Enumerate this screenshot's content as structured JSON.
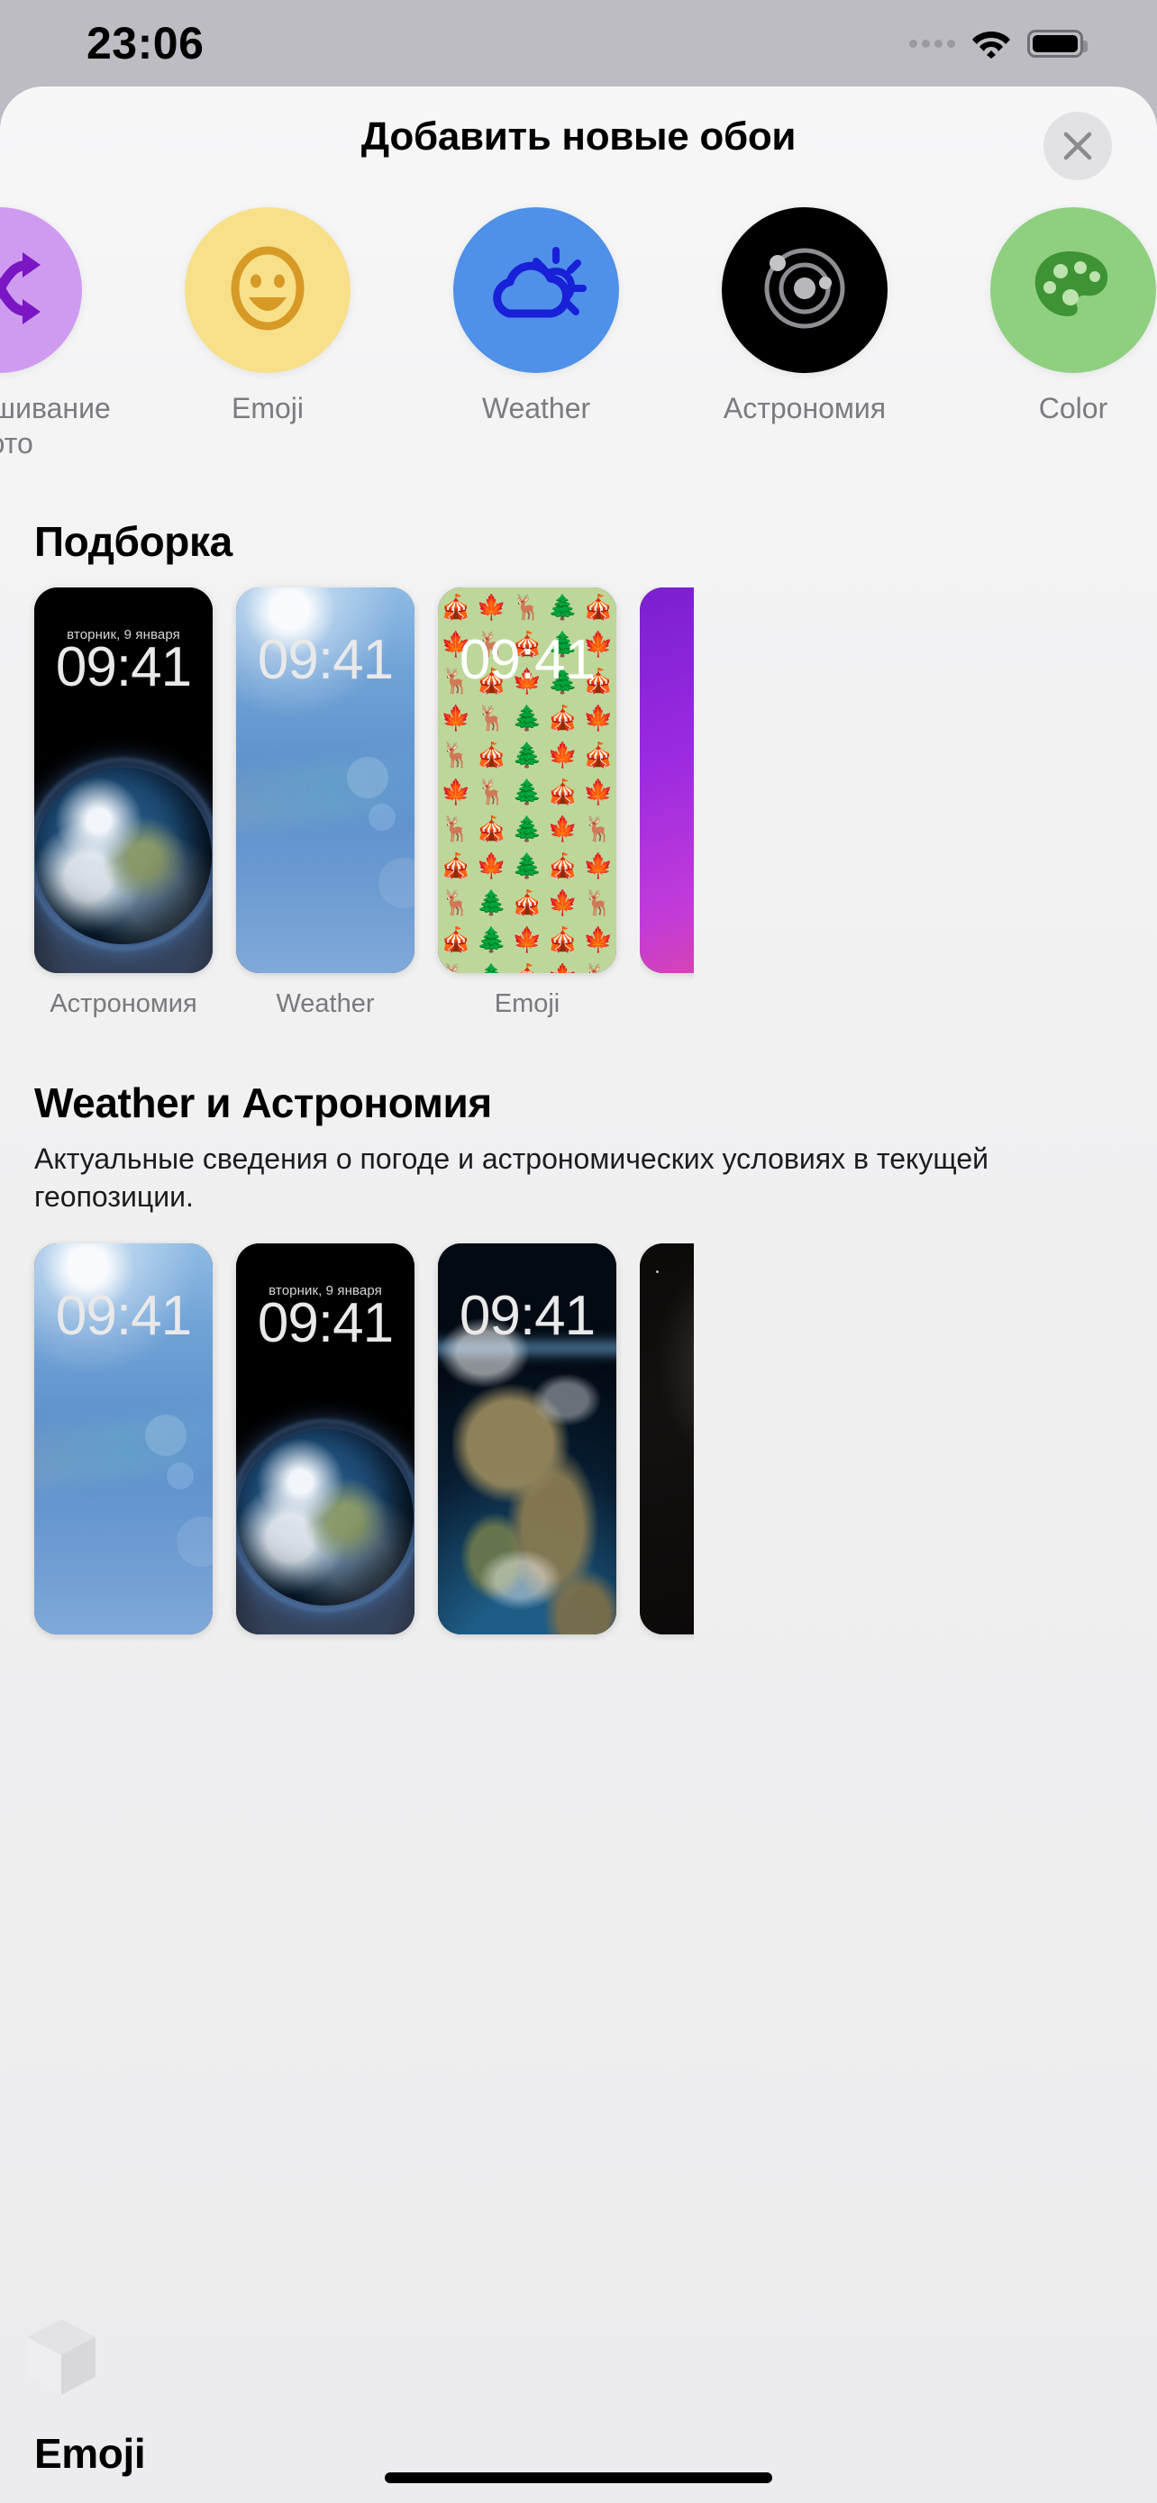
{
  "status_bar": {
    "time": "23:06",
    "wifi_icon": "wifi-icon",
    "battery_icon": "battery-icon",
    "signal_icon": "cellular-dots-icon"
  },
  "header": {
    "title": "Добавить новые обои",
    "close_icon": "close-icon"
  },
  "categories": [
    {
      "label": "Перемешивание фото",
      "icon": "shuffle-icon",
      "bg": "#cf9bf0",
      "fg": "#7a16c4"
    },
    {
      "label": "Emoji",
      "icon": "smiley-icon",
      "bg": "#f7e089",
      "fg": "#d79a26"
    },
    {
      "label": "Weather",
      "icon": "sun-behind-cloud-icon",
      "bg": "#4f90e8",
      "fg": "#1820d8"
    },
    {
      "label": "Астрономия",
      "icon": "solar-system-icon",
      "bg": "#000000",
      "fg": "#9a9a9a"
    },
    {
      "label": "Color",
      "icon": "paint-palette-icon",
      "bg": "#8fd080",
      "fg": "#3e9434"
    }
  ],
  "sections": [
    {
      "title": "Подборка",
      "description": "",
      "cards": [
        {
          "caption": "Астрономия",
          "style": "astronomy-earth",
          "date": "вторник, 9 января",
          "time": "09:41"
        },
        {
          "caption": "Weather",
          "style": "weather-blue-sky",
          "date": "",
          "time": "09:41"
        },
        {
          "caption": "Emoji",
          "style": "emoji-pattern",
          "date": "",
          "time": "09:41"
        },
        {
          "caption": "",
          "style": "purple-gradient",
          "date": "",
          "time": ""
        }
      ]
    },
    {
      "title": "Weather и Астрономия",
      "description": "Актуальные сведения о погоде и астрономических условиях в текущей геопозиции.",
      "cards": [
        {
          "caption": "",
          "style": "weather-blue-sky",
          "date": "",
          "time": "09:41"
        },
        {
          "caption": "",
          "style": "astronomy-earth",
          "date": "вторник, 9 января",
          "time": "09:41"
        },
        {
          "caption": "",
          "style": "earth-closeup",
          "date": "",
          "time": "09:41"
        },
        {
          "caption": "",
          "style": "night-sky",
          "date": "",
          "time": ""
        }
      ]
    }
  ],
  "bottom_section": {
    "title": "Emoji",
    "icon": "emoji-cube-icon"
  },
  "emoji_pattern": {
    "glyphs": [
      "🎪",
      "🍁",
      "🦌",
      "🌲",
      "🎪",
      "🍁",
      "🦌",
      "🎪",
      "🌲",
      "🍁",
      "🦌",
      "🎪",
      "🍁",
      "🌲",
      "🎪",
      "🍁",
      "🦌",
      "🌲",
      "🎪",
      "🍁",
      "🦌",
      "🎪",
      "🌲",
      "🍁",
      "🎪",
      "🍁",
      "🦌",
      "🌲",
      "🎪",
      "🍁",
      "🦌",
      "🎪",
      "🌲",
      "🍁",
      "🦌",
      "🎪",
      "🍁",
      "🌲",
      "🎪",
      "🍁",
      "🦌",
      "🌲",
      "🎪",
      "🍁",
      "🦌",
      "🎪",
      "🌲",
      "🍁",
      "🎪",
      "🍁",
      "🦌",
      "🌲",
      "🎪",
      "🍁",
      "🦌",
      "🎪",
      "🌲",
      "🍁",
      "🦌",
      "🎪",
      "🍁",
      "🌲",
      "🎪",
      "🍁",
      "🦌"
    ],
    "background": "#bdd79a"
  },
  "colors": {
    "sheet_bg": "#f4f4f5",
    "page_bg": "#bcbcc2",
    "caption_gray": "#79797e",
    "title_black": "#000000"
  }
}
